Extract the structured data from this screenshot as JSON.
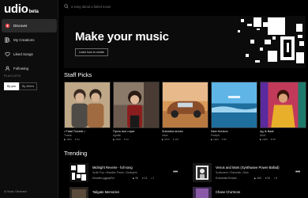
{
  "brand": {
    "name": "udio",
    "badge": "beta"
  },
  "search": {
    "placeholder": "a song about a failed exam"
  },
  "sidebar": {
    "items": [
      {
        "label": "Discover",
        "icon": "compass-icon",
        "active": true
      },
      {
        "label": "My Creations",
        "icon": "library-icon",
        "active": false
      },
      {
        "label": "Liked Songs",
        "icon": "heart-icon",
        "active": false
      },
      {
        "label": "Following",
        "icon": "person-icon",
        "active": false
      }
    ],
    "playlists_label": "PLAYLISTS",
    "playlist_tabs": [
      "By you",
      "By others"
    ],
    "footer": "AI Music Generator"
  },
  "hero": {
    "title": "Make your music",
    "button": "Learn how to create"
  },
  "staff_picks": {
    "title": "Staff Picks",
    "cards": [
      {
        "title": "• Fatal Trouble •",
        "artist": "Thaxia",
        "plays": "1684",
        "likes": "93"
      },
      {
        "title": "Пусть все горит",
        "artist": "Agrafin",
        "plays": "2639",
        "likes": "43"
      },
      {
        "title": "Suburbia dunes",
        "artist": "nouin",
        "plays": "3572",
        "likes": "107"
      },
      {
        "title": "New Horizon",
        "artist": "Paneplt",
        "plays": "1900",
        "likes": "86"
      },
      {
        "title": "Ag Ik Baat",
        "artist": "Atlo3",
        "plays": "1909",
        "likes": "95"
      }
    ]
  },
  "trending": {
    "title": "Trending",
    "items": [
      {
        "title": "Midnight Reverie - full song",
        "tags": "Synth Pop  •  Brazilian Phonk  •  Darksynth",
        "artist": "Dreaded pggrapPer",
        "plays": "95",
        "likes": "13",
        "extra": "1"
      },
      {
        "title": "Venus and Mars (Synthwave Power Ballad)",
        "tags": "Synthwave  •  Romantic  •  Slow",
        "artist": "Enchanted Echoes",
        "plays": "460",
        "likes": "53",
        "extra": "8"
      },
      {
        "title": "Tailgate Memories",
        "tags": "",
        "artist": "",
        "plays": "",
        "likes": "",
        "extra": ""
      },
      {
        "title": "Chase Cha'more",
        "tags": "",
        "artist": "",
        "plays": "",
        "likes": "",
        "extra": ""
      }
    ]
  },
  "colors": {
    "background": "#000000",
    "sidebar": "#0d0d0d",
    "active_nav": "#2a2a2a",
    "accent_text": "#ffffff"
  }
}
